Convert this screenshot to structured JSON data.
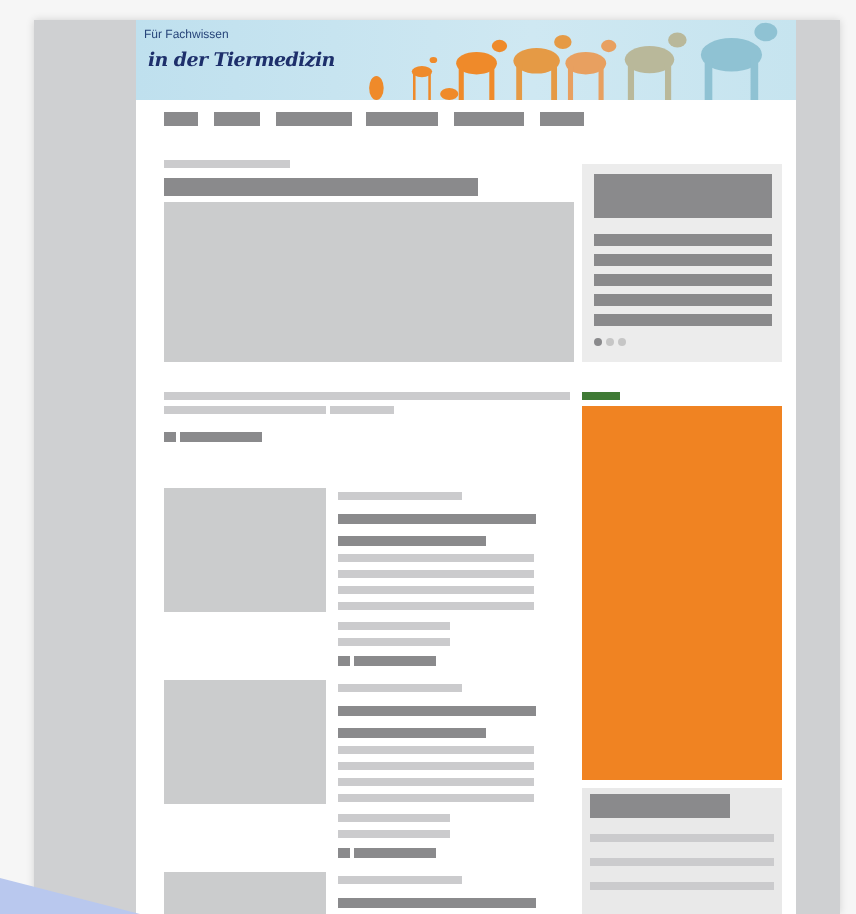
{
  "banner": {
    "tagline": "Für Fachwissen",
    "title": "in der Tiermedizin"
  }
}
